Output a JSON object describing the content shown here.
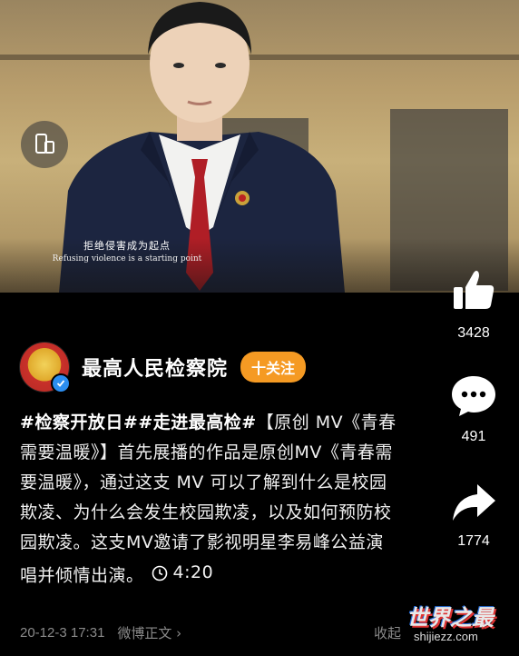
{
  "video": {
    "subtitle_zh": "拒绝侵害成为起点",
    "subtitle_en": "Refusing violence is a starting point"
  },
  "actions": {
    "like_count": "3428",
    "comment_count": "491",
    "share_count": "1774"
  },
  "account": {
    "name": "最高人民检察院",
    "follow_label": "十关注"
  },
  "post": {
    "hashtags": "#检察开放日##走进最高检#",
    "body": "【原创 MV《青春需要温暖》】首先展播的作品是原创MV《青春需要温暖》，通过这支 MV 可以了解到什么是校园欺凌、为什么会发生校园欺凌，以及如何预防校园欺凌。这支MV邀请了影视明星李易峰公益演唱并倾情出演。",
    "duration": "4:20"
  },
  "meta": {
    "date": "20-12-3 17:31",
    "source": "微博正文 ›",
    "collapse": "收起"
  },
  "watermark": {
    "text": "世界之最",
    "url": "shijiezz.com"
  },
  "colors": {
    "background": "#000000",
    "follow_button": "#f59a23",
    "verified_badge": "#2c8ef0",
    "meta_text": "#8a8a8a"
  },
  "icons": [
    "cast-screen-icon",
    "thumbs-up-icon",
    "comment-bubble-icon",
    "share-arrow-icon",
    "clock-icon",
    "verified-icon"
  ]
}
